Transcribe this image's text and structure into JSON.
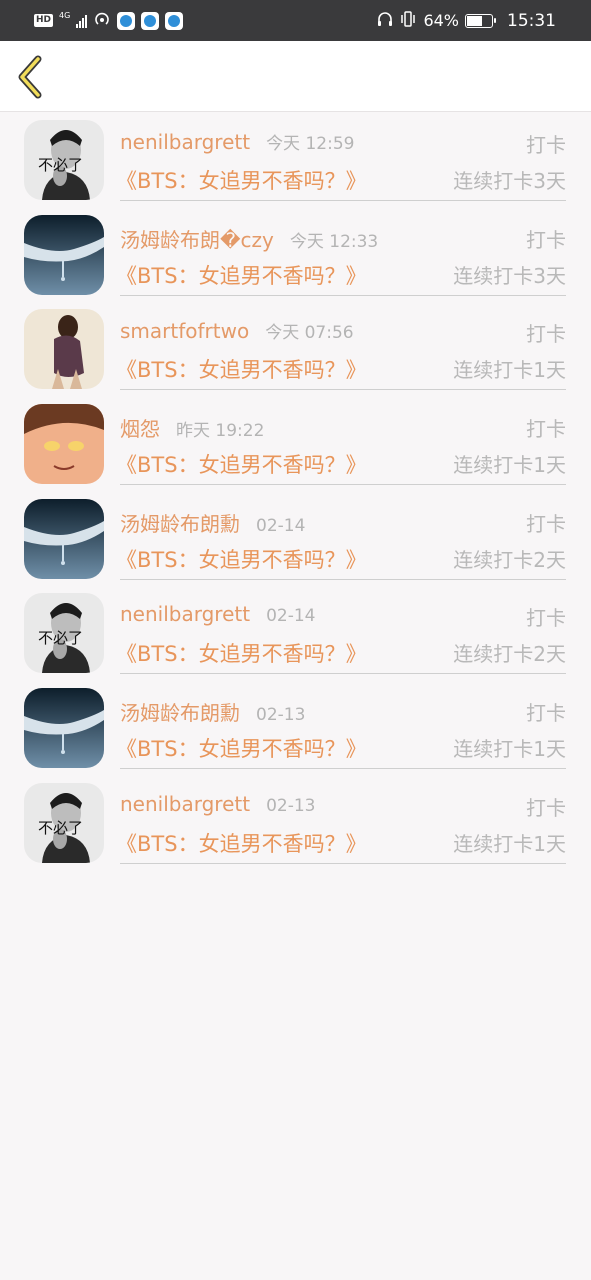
{
  "status_bar": {
    "hd": "HD",
    "network": "4G",
    "battery_percent": "64%",
    "battery_level": 0.64,
    "time": "15:31"
  },
  "nav": {
    "back_icon": "chevron-left-icon",
    "accent_color": "#f2dd5a"
  },
  "colors": {
    "username": "#e49a68",
    "book_title": "#e8955a",
    "muted": "#b8b8b8"
  },
  "records": [
    {
      "avatar": "avatar-text-style",
      "username": "nenilbargrett",
      "time": "今天 12:59",
      "action": "打卡",
      "book": "《BTS：女追男不香吗？》",
      "streak": "连续打卡3天"
    },
    {
      "avatar": "avatar-hand-style",
      "username": "汤姆龄布朗�czy",
      "time": "今天 12:33",
      "action": "打卡",
      "book": "《BTS：女追男不香吗？》",
      "streak": "连续打卡3天"
    },
    {
      "avatar": "avatar-photo-style",
      "username": "smartfofrtwo",
      "time": "今天 07:56",
      "action": "打卡",
      "book": "《BTS：女追男不香吗？》",
      "streak": "连续打卡1天"
    },
    {
      "avatar": "avatar-anime-style",
      "username": "烟怨",
      "time": "昨天 19:22",
      "action": "打卡",
      "book": "《BTS：女追男不香吗？》",
      "streak": "连续打卡1天"
    },
    {
      "avatar": "avatar-hand-style",
      "username": "汤姆龄布朗勳",
      "time": "02-14",
      "action": "打卡",
      "book": "《BTS：女追男不香吗？》",
      "streak": "连续打卡2天"
    },
    {
      "avatar": "avatar-text-style",
      "username": "nenilbargrett",
      "time": "02-14",
      "action": "打卡",
      "book": "《BTS：女追男不香吗？》",
      "streak": "连续打卡2天"
    },
    {
      "avatar": "avatar-hand-style",
      "username": "汤姆龄布朗勳",
      "time": "02-13",
      "action": "打卡",
      "book": "《BTS：女追男不香吗？》",
      "streak": "连续打卡1天"
    },
    {
      "avatar": "avatar-text-style",
      "username": "nenilbargrett",
      "time": "02-13",
      "action": "打卡",
      "book": "《BTS：女追男不香吗？》",
      "streak": "连续打卡1天"
    }
  ],
  "avatar_caption": "不必了"
}
